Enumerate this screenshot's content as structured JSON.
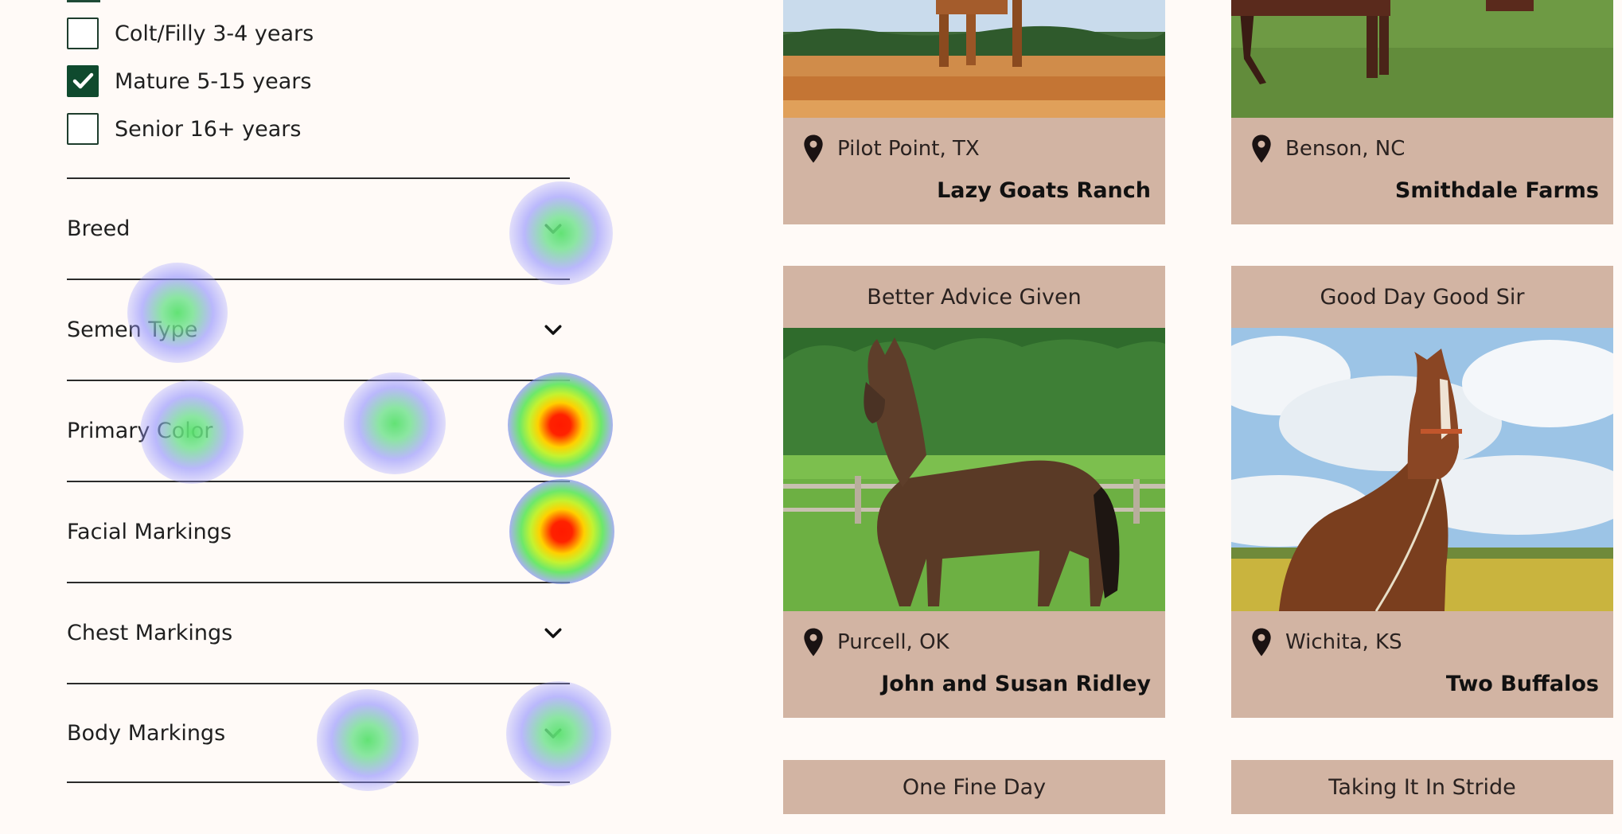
{
  "filters": {
    "age_options": [
      {
        "label": "Colt/Filly 3-4 years",
        "checked": false
      },
      {
        "label": "Mature 5-15 years",
        "checked": true
      },
      {
        "label": "Senior 16+ years",
        "checked": false
      }
    ],
    "sections": [
      {
        "label": "Breed"
      },
      {
        "label": "Semen Type"
      },
      {
        "label": "Primary Color"
      },
      {
        "label": "Facial Markings"
      },
      {
        "label": "Chest Markings"
      },
      {
        "label": "Body Markings"
      }
    ]
  },
  "listings": [
    {
      "title": "",
      "location": "Pilot Point, TX",
      "owner": "Lazy Goats Ranch"
    },
    {
      "title": "",
      "location": "Benson, NC",
      "owner": "Smithdale Farms"
    },
    {
      "title": "Better Advice Given",
      "location": "Purcell, OK",
      "owner": "John and Susan Ridley"
    },
    {
      "title": "Good Day Good Sir",
      "location": "Wichita, KS",
      "owner": "Two Buffalos"
    },
    {
      "title": "One Fine Day",
      "location": "",
      "owner": ""
    },
    {
      "title": "Taking It In Stride",
      "location": "",
      "owner": ""
    }
  ],
  "icons": {
    "checkbox_check": "check-icon",
    "section_toggle": "chevron-down-icon",
    "location": "map-pin-icon"
  },
  "colors": {
    "brand_green": "#0f4a2e",
    "card_tan": "#d2b4a3",
    "page_bg": "#fffaf7"
  }
}
